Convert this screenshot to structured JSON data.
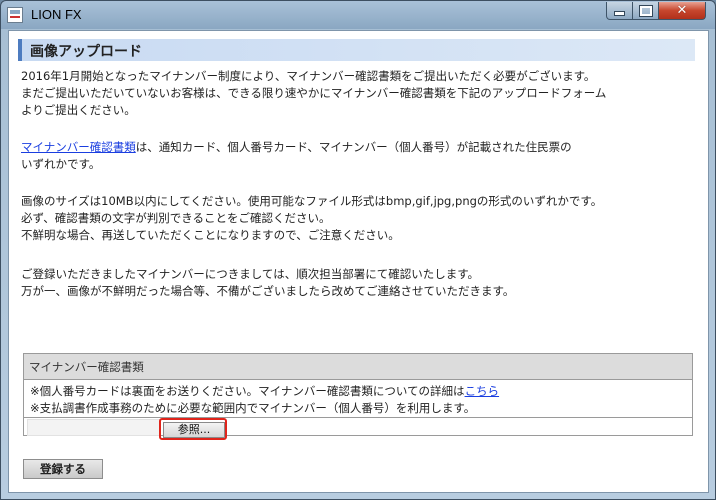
{
  "window": {
    "title": "LION FX",
    "close_glyph": "✕"
  },
  "page": {
    "heading": "画像アップロード",
    "intro": [
      "2016年1月開始となったマイナンバー制度により、マイナンバー確認書類をご提出いただく必要がございます。",
      "まだご提出いただいていないお客様は、できる限り速やかにマイナンバー確認書類を下記のアップロードフォーム",
      "よりご提出ください。"
    ],
    "doc_link": "マイナンバー確認書類",
    "doc_desc_1": "は、通知カード、個人番号カード、マイナンバー（個人番号）が記載された住民票の",
    "doc_desc_2": "いずれかです。",
    "image_rules": [
      "画像のサイズは10MB以内にしてください。使用可能なファイル形式はbmp,gif,jpg,pngの形式のいずれかです。",
      "必ず、確認書類の文字が判別できることをご確認ください。",
      "不鮮明な場合、再送していただくことになりますので、ご注意ください。"
    ],
    "closing": [
      "ご登録いただきましたマイナンバーにつきましては、順次担当部署にて確認いたします。",
      "万が一、画像が不鮮明だった場合等、不備がございましたら改めてご連絡させていただきます。"
    ]
  },
  "upload_box": {
    "header": "マイナンバー確認書類",
    "note_1": "※個人番号カードは裏面をお送りください。マイナンバー確認書類についての詳細は",
    "note_1_link": "こちら",
    "note_2": "※支払調書作成事務のために必要な範囲内でマイナンバー（個人番号）を利用します。",
    "browse_label": "参照..."
  },
  "submit_label": "登録する",
  "colors": {
    "accent": "#4d7cc0",
    "link": "#1a3ee0",
    "highlight_outline": "#e0241b",
    "close_button": "#c7462d"
  }
}
